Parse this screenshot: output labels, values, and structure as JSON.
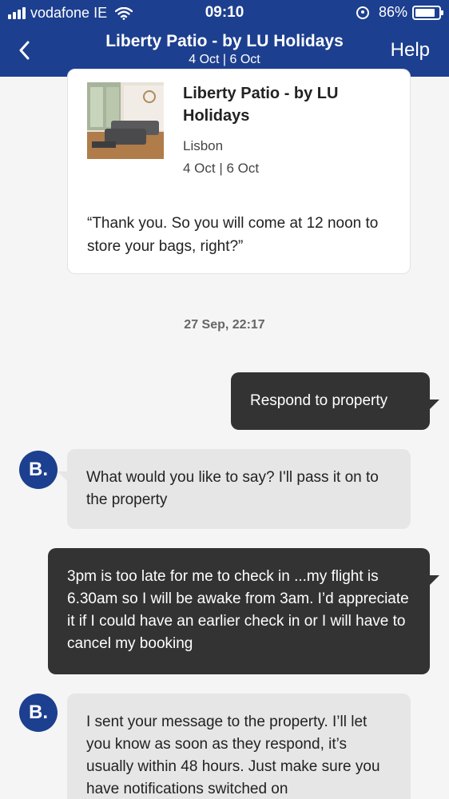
{
  "status_bar": {
    "carrier": "vodafone IE",
    "time": "09:10",
    "battery": "86%",
    "battery_level": 0.86
  },
  "header": {
    "title": "Liberty Patio - by LU Holidays",
    "subtitle": "4 Oct | 6 Oct",
    "help_label": "Help",
    "icons": {
      "back": "chevron-left-icon"
    }
  },
  "property_card": {
    "name": "Liberty Patio - by LU Holidays",
    "city": "Lisbon",
    "dates": "4 Oct | 6 Oct",
    "quote": "“Thank you. So you will come at 12 noon to store your bags, right?”"
  },
  "conversation": {
    "date_stamp": "27 Sep, 22:17",
    "messages": [
      {
        "from": "user",
        "text": "Respond to property"
      },
      {
        "from": "booking",
        "avatar": "B.",
        "text": "What would you like to say? I'll pass it on to the property"
      },
      {
        "from": "user",
        "text": "3pm is too late for me to check in ...my flight is 6.30am so I will be awake from 3am. I’d appreciate it if I could have an earlier check in or I will have to cancel my booking"
      },
      {
        "from": "booking",
        "avatar": "B.",
        "text": "I sent your message to the property. I’ll let you know as soon as they respond, it’s usually within 48 hours. Just make sure you have notifications switched on"
      }
    ]
  },
  "colors": {
    "brand": "#1d3f8f",
    "user_bubble": "#333333",
    "bot_bubble": "#e6e6e6",
    "avatar_dot": "#6ab2f1"
  }
}
